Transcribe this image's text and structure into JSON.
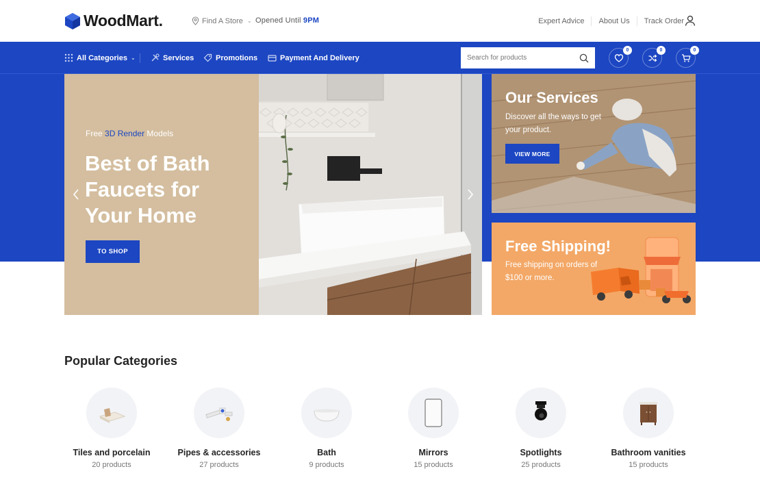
{
  "header": {
    "logo_text": "WoodMart.",
    "find_store": "Find A Store",
    "opened_prefix": "Opened Until",
    "opened_time": "9PM",
    "links": [
      "Expert Advice",
      "About Us",
      "Track Order"
    ]
  },
  "nav": {
    "all_categories": "All Categories",
    "services": "Services",
    "promotions": "Promotions",
    "payment": "Payment And Delivery",
    "search_placeholder": "Search for products",
    "wishlist_count": "0",
    "compare_count": "0",
    "cart_count": "0"
  },
  "hero": {
    "subtitle_prefix": "Free",
    "subtitle_highlight": "3D Render",
    "subtitle_suffix": "Models",
    "title": "Best of Bath Faucets for Your Home",
    "button": "TO SHOP"
  },
  "services_banner": {
    "title": "Our Services",
    "text": "Discover all the ways to get your product.",
    "button": "VIEW MORE"
  },
  "shipping_banner": {
    "title": "Free Shipping!",
    "text": "Free shipping on orders of $100 or more."
  },
  "categories": {
    "title": "Popular Categories",
    "items": [
      {
        "name": "Tiles and porcelain",
        "count": "20 products"
      },
      {
        "name": "Pipes & accessories",
        "count": "27 products"
      },
      {
        "name": "Bath",
        "count": "9 products"
      },
      {
        "name": "Mirrors",
        "count": "15 products"
      },
      {
        "name": "Spotlights",
        "count": "25 products"
      },
      {
        "name": "Bathroom vanities",
        "count": "15 products"
      }
    ]
  },
  "colors": {
    "brand_blue": "#1c46c2",
    "hero_beige": "#d4be9f",
    "shipping_orange": "#f3a867"
  },
  "icons": [
    "logo-mark-icon",
    "location-pin-icon",
    "user-icon",
    "grid-icon",
    "tools-icon",
    "tag-icon",
    "payment-icon",
    "search-icon",
    "heart-icon",
    "compare-icon",
    "cart-icon",
    "chevron-left-icon",
    "chevron-right-icon"
  ]
}
